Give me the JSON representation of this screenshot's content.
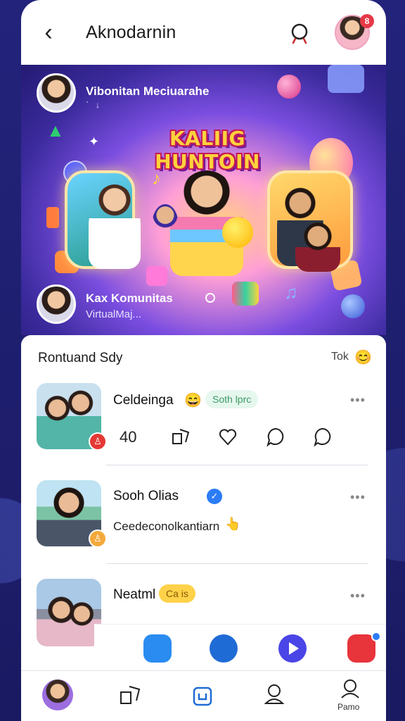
{
  "header": {
    "title": "Aknodarnin",
    "back_icon": "chevron-left-icon",
    "search_icon": "search-icon",
    "notification_badge": "8"
  },
  "hero": {
    "top_user_name": "Vibonitan Meciuarahe",
    "banner_title": "KALIIG HUNTOIN",
    "bottom_user_name": "Kax Komunitas",
    "bottom_user_sub": "VirtualMaj..."
  },
  "feed": {
    "header": "Rontuand Sdy",
    "action_label": "Tok",
    "posts": [
      {
        "name": "Celdeinga",
        "emoji": "😄",
        "chip": "Soth lprc",
        "chip_color": "#e6f7ee",
        "chip_text_color": "#3a9a66",
        "badge_color": "#e53935",
        "stats": [
          "40"
        ]
      },
      {
        "name": "Sooh Olias",
        "text": "Ceedeconolkantiarn",
        "text_emoji": "👆",
        "badge_color": "#f4a93b",
        "verified_color": "#2b7cf6"
      },
      {
        "name": "Neatml",
        "chip": "Ca is",
        "chip_color": "#ffd24a",
        "chip_text_color": "#8a5a00"
      }
    ]
  },
  "dock": {
    "apps": [
      {
        "name": "chat-app-icon",
        "color": "#2a8cf0"
      },
      {
        "name": "stats-app-icon",
        "color": "#1f6bd6"
      },
      {
        "name": "play-app-icon",
        "color": "#4a45e6"
      },
      {
        "name": "game-app-icon",
        "color": "#e8343b"
      }
    ]
  },
  "bottom_nav": {
    "items": [
      {
        "name": "profile-avatar-nav"
      },
      {
        "name": "shapes-icon"
      },
      {
        "name": "upload-icon"
      },
      {
        "name": "bell-user-icon"
      },
      {
        "name": "person-icon"
      }
    ],
    "last_label": "Pamo"
  }
}
